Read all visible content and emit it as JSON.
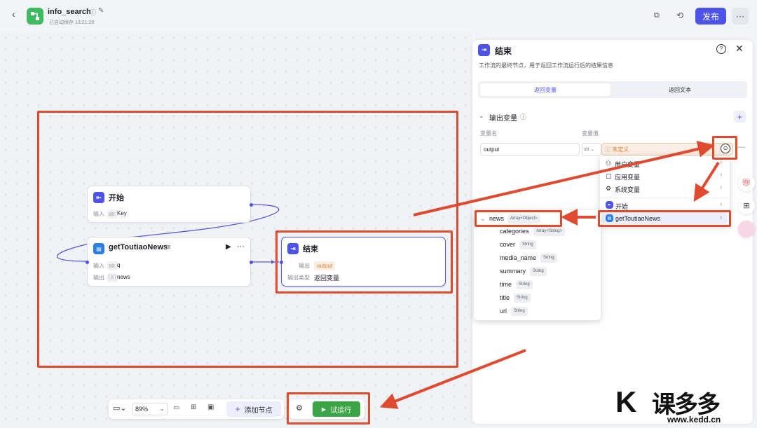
{
  "header": {
    "app_name": "info_search",
    "autosave": "已自动保存 13:21:29",
    "publish_label": "发布"
  },
  "canvas": {
    "nodes": {
      "start": {
        "title": "开始",
        "input_label": "输入",
        "input_type": "str.",
        "input_value": "Key"
      },
      "news": {
        "title": "getToutiaoNews",
        "input_label": "输入",
        "input_type": "str.",
        "input_value": "q",
        "output_label": "输出",
        "output_type": "[ ]{ }",
        "output_value": "news"
      },
      "end": {
        "title": "结束",
        "output_label": "输出",
        "output_value": "output",
        "output_type_label": "输出类型",
        "output_type_value": "返回变量"
      }
    }
  },
  "toolbar": {
    "zoom": "89%",
    "add_node_label": "添加节点",
    "run_label": "试运行"
  },
  "panel": {
    "title": "结束",
    "description": "工作流的最终节点，用于返回工作流运行后的结果信息",
    "tabs": [
      "返回变量",
      "返回文本"
    ],
    "section_title": "输出变量",
    "col_name": "变量名",
    "col_value": "变量值",
    "var_name": "output",
    "var_type": "str.",
    "var_value": "未定义"
  },
  "dropdown": {
    "items": [
      "用户变量",
      "应用变量",
      "系统变量",
      "开始",
      "getToutiaoNews"
    ]
  },
  "submenu": {
    "root_name": "news",
    "root_type": "Array<Object>",
    "fields": [
      {
        "name": "categories",
        "type": "Array<String>"
      },
      {
        "name": "cover",
        "type": "String"
      },
      {
        "name": "media_name",
        "type": "String"
      },
      {
        "name": "summary",
        "type": "String"
      },
      {
        "name": "time",
        "type": "String"
      },
      {
        "name": "title",
        "type": "String"
      },
      {
        "name": "url",
        "type": "String"
      }
    ]
  },
  "watermark": {
    "text": "课多多",
    "url": "www.kedd.cn"
  },
  "colors": {
    "accent": "#4d53e8",
    "annotation_red": "#e04b2f",
    "run_green": "#3aa545",
    "undefined_orange": "#d9822b"
  }
}
